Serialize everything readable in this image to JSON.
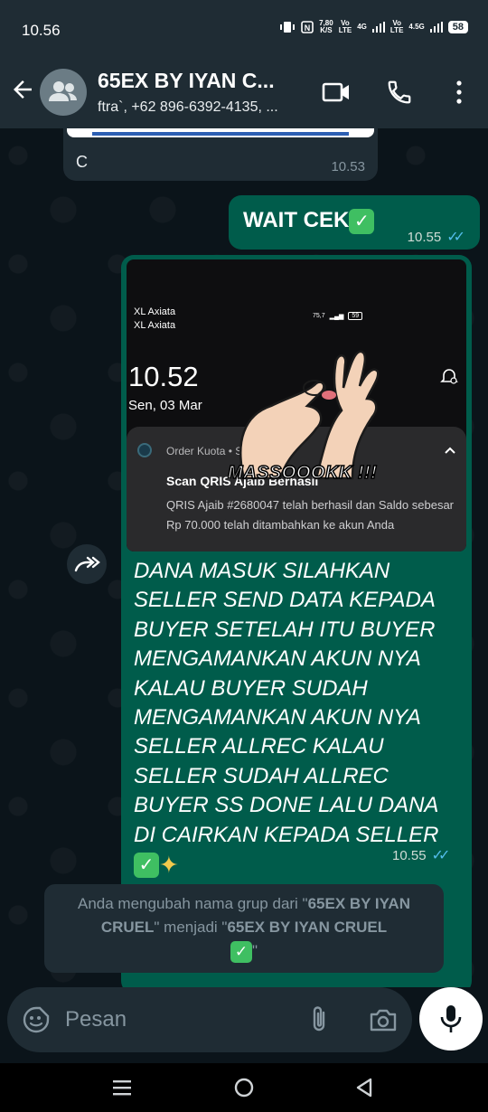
{
  "status_bar": {
    "time": "10.56",
    "net_speed_top": "7,80",
    "net_speed_bottom": "K/S",
    "volte1_top": "Vo",
    "volte1_bottom": "LTE",
    "net1": "4G",
    "volte2_top": "Vo",
    "volte2_bottom": "LTE",
    "net2": "4.5G",
    "battery": "58"
  },
  "header": {
    "title": "65EX BY IYAN C...",
    "subtitle": "ftra`, +62 896-6392-4135, ..."
  },
  "messages": {
    "first": {
      "text": "C",
      "time": "10.53"
    },
    "wait": {
      "text": "WAIT CEK",
      "time": "10.55"
    },
    "image": {
      "carrier1": "XL Axiata",
      "carrier2": "XL Axiata",
      "lock_time": "10.52",
      "lock_date": "Sen, 03 Mar",
      "status_speed": "75,7",
      "battery": "59",
      "notif_app": "Order Kuota • Sekarang",
      "notif_title": "Scan QRIS Ajaib Berhasil",
      "notif_body": "QRIS Ajaib #2680047 telah berhasil dan Saldo sebesar Rp 70.000 telah ditambahkan ke akun Anda",
      "sticker_text": "MASSOOOKK !!!"
    },
    "long_text": "DANA MASUK SILAHKAN SELLER SEND DATA KEPADA BUYER SETELAH ITU BUYER MENGAMANKAN AKUN NYA KALAU BUYER SUDAH MENGAMANKAN AKUN NYA SELLER ALLREC KALAU SELLER SUDAH ALLREC BUYER SS DONE LALU DANA DI CAIRKAN KEPADA SELLER",
    "long_time": "10.55"
  },
  "system_message": {
    "prefix": "Anda mengubah nama grup dari \"",
    "old_name": "65EX BY IYAN CRUEL",
    "middle": "\" menjadi \"",
    "new_name": "65EX BY IYAN CRUEL",
    "suffix": "\""
  },
  "input": {
    "placeholder": "Pesan"
  },
  "colors": {
    "header_bg": "#1f2c34",
    "outgoing_bubble": "#005c4b",
    "incoming_bubble": "#1f2c34",
    "read_tick": "#53bdeb"
  },
  "icons": [
    "back-arrow-icon",
    "group-avatar-icon",
    "video-call-icon",
    "phone-icon",
    "more-icon",
    "forward-icon",
    "sticker-icon",
    "attach-icon",
    "camera-icon",
    "mic-icon",
    "nav-menu-icon",
    "nav-home-icon",
    "nav-back-icon"
  ]
}
